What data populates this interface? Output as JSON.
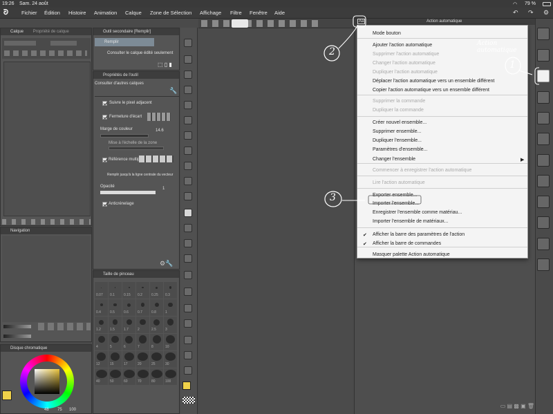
{
  "status": {
    "time": "19:26",
    "date": "Sam. 24 août",
    "battery": "79 %"
  },
  "menubar": {
    "items": [
      "Fichier",
      "Édition",
      "Histoire",
      "Animation",
      "Calque",
      "Zone de Sélection",
      "Affichage",
      "Filtre",
      "Fenêtre",
      "Aide"
    ]
  },
  "layer_panel": {
    "tab1": "Calque",
    "tab2": "Propriété de calque"
  },
  "subtool": {
    "title": "Outil secondaire [Remplir]",
    "item": "Remplir",
    "item2": "Consulter le calque édité seulement"
  },
  "tool_props": {
    "title": "Propriétés de l'outil",
    "header": "Consulter d'autres calques",
    "opt1": "Suivre le pixel adjacent",
    "opt2": "Fermeture d'écart",
    "opt3": "Marge de couleur",
    "opt3_value": "14.6",
    "opt4": "Mise à l'échelle de la zone",
    "opt5": "Référence multiple",
    "opt6": "Remplir jusqu'à la ligne centrale du vecteur",
    "opt7": "Opacité",
    "opt7_value": "1",
    "opt8": "Anticrénelage"
  },
  "navigation": {
    "title": "Navigation"
  },
  "color": {
    "title": "Disque chromatique",
    "values": [
      "48",
      "75",
      "100"
    ]
  },
  "brush_size": {
    "title": "Taille de pinceau",
    "sizes": [
      "0.07",
      "0.1",
      "0.15",
      "0.2",
      "0.25",
      "0.3",
      "0.4",
      "0.5",
      "0.6",
      "0.7",
      "0.8",
      "1",
      "1.2",
      "1.5",
      "1.7",
      "2",
      "2.5",
      "3",
      "4",
      "5",
      "6",
      "7",
      "8",
      "10",
      "12",
      "15",
      "17",
      "20",
      "25",
      "30",
      "40",
      "50",
      "60",
      "70",
      "80",
      "100"
    ]
  },
  "action_window": {
    "title": "Action automatique",
    "badge": "Aa"
  },
  "dropdown": {
    "items": [
      {
        "label": "Mode bouton",
        "disabled": false
      },
      {
        "label": "Ajouter l'action automatique",
        "disabled": false
      },
      {
        "label": "Supprimer l'action automatique",
        "disabled": true
      },
      {
        "label": "Changer l'action automatique",
        "disabled": true
      },
      {
        "label": "Dupliquer l'action automatique",
        "disabled": true
      },
      {
        "label": "Déplacer l'action automatique vers un ensemble différent",
        "disabled": false
      },
      {
        "label": "Copier l'action automatique vers un ensemble différent",
        "disabled": false
      },
      {
        "label": "Supprimer la commande",
        "disabled": true
      },
      {
        "label": "Dupliquer la commande",
        "disabled": true
      },
      {
        "label": "Créer nouvel ensemble...",
        "disabled": false
      },
      {
        "label": "Supprimer ensemble...",
        "disabled": false
      },
      {
        "label": "Dupliquer l'ensemble...",
        "disabled": false
      },
      {
        "label": "Paramètres d'ensemble...",
        "disabled": false
      },
      {
        "label": "Changer l'ensemble",
        "disabled": false
      },
      {
        "label": "Commencer à enregistrer l'action automatique",
        "disabled": true
      },
      {
        "label": "Lire l'action automatique",
        "disabled": true
      },
      {
        "label": "Exporter ensemble...",
        "disabled": false
      },
      {
        "label": "Importer l'ensemble...",
        "disabled": false
      },
      {
        "label": "Enregistrer l'ensemble comme matériau...",
        "disabled": false
      },
      {
        "label": "Importer l'ensemble de matériaux...",
        "disabled": false
      },
      {
        "label": "Afficher la barre des paramètres de l'action",
        "disabled": false
      },
      {
        "label": "Afficher la barre de commandes",
        "disabled": false
      },
      {
        "label": "Masquer palette Action automatique",
        "disabled": false
      }
    ]
  },
  "annotations": {
    "n1": "1",
    "n2": "2",
    "n3": "3",
    "handwritten": "Action automatique"
  },
  "colors": {
    "accent": "#4da0e0",
    "main_fg": "#f0d24a",
    "menu_bg": "#f4f4f4"
  }
}
